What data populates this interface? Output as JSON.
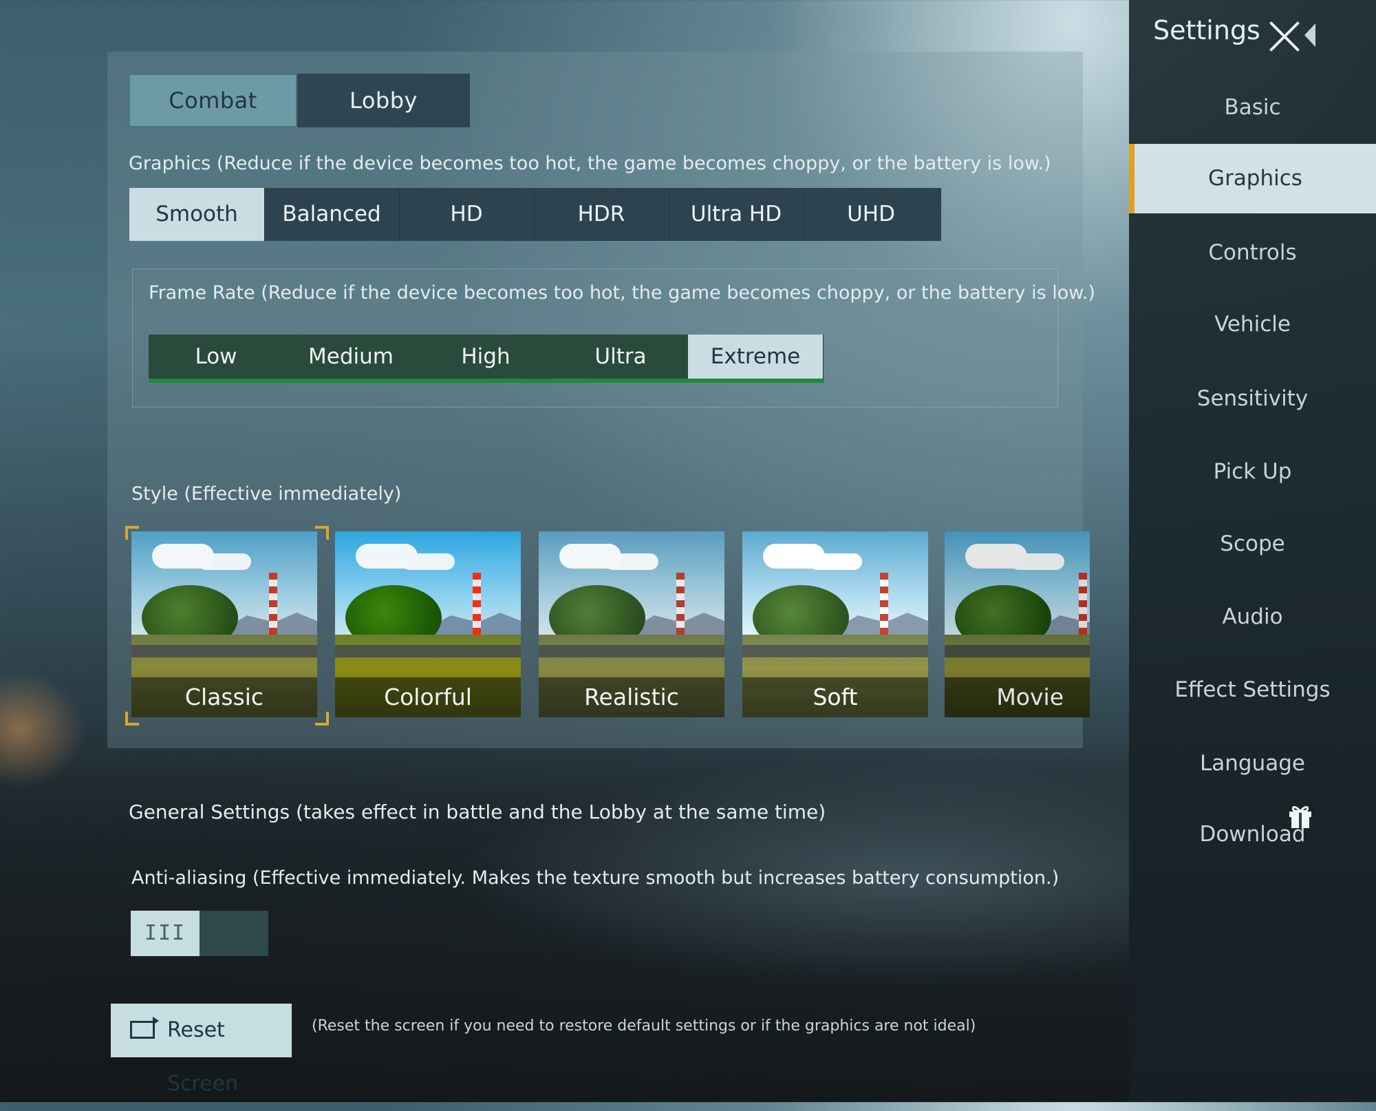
{
  "tabs": [
    "Combat",
    "Lobby"
  ],
  "active_tab": "Combat",
  "graphics": {
    "label": "Graphics (Reduce if the device becomes too hot, the game becomes choppy, or the battery is low.)",
    "options": [
      "Smooth",
      "Balanced",
      "HD",
      "HDR",
      "Ultra HD",
      "UHD"
    ],
    "selected": "Smooth"
  },
  "frame_rate": {
    "label": "Frame Rate (Reduce if the device becomes too hot, the game becomes choppy, or the battery is low.)",
    "options": [
      "Low",
      "Medium",
      "High",
      "Ultra",
      "Extreme"
    ],
    "selected": "Extreme"
  },
  "style": {
    "label": "Style (Effective immediately)",
    "options": [
      "Classic",
      "Colorful",
      "Realistic",
      "Soft",
      "Movie"
    ],
    "selected": "Classic"
  },
  "general": {
    "label": "General Settings (takes effect in battle and the Lobby at the same time)",
    "anti_aliasing_label": "Anti-aliasing (Effective immediately. Makes the texture smooth but increases battery consumption.)",
    "anti_aliasing_knob": "III"
  },
  "reset": {
    "button": "Reset Screen",
    "note": "(Reset the screen if you need to restore default settings or if the graphics are not ideal)"
  },
  "sidebar": {
    "title": "Settings",
    "items": [
      "Basic",
      "Graphics",
      "Controls",
      "Vehicle",
      "Sensitivity",
      "Pick Up",
      "Scope",
      "Audio",
      "Effect Settings",
      "Language",
      "Download"
    ],
    "active": "Graphics"
  },
  "colors": {
    "accent": "#e0a020",
    "frame_rate_underline": "#1f8a3a",
    "selected_bg": "#c9dde2"
  }
}
